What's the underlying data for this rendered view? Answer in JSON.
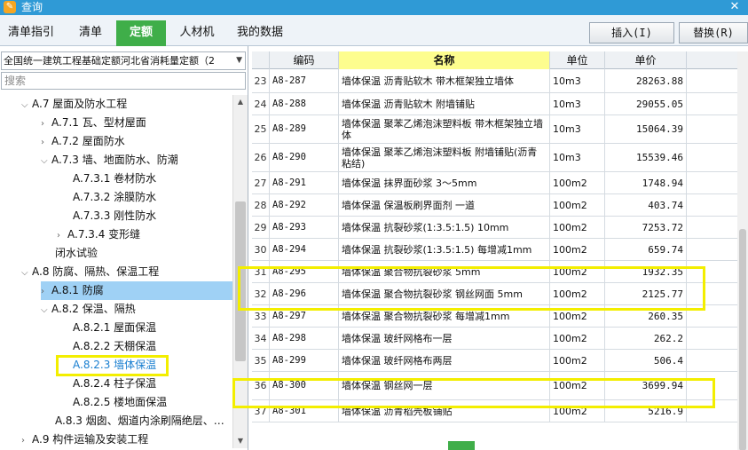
{
  "window": {
    "title": "查询",
    "close_label": "✕"
  },
  "tabs": [
    {
      "label": "清单指引",
      "active": false
    },
    {
      "label": "清单",
      "active": false
    },
    {
      "label": "定额",
      "active": true
    },
    {
      "label": "人材机",
      "active": false
    },
    {
      "label": "我的数据",
      "active": false
    }
  ],
  "buttons": {
    "insert": "插入(I)",
    "replace": "替换(R)"
  },
  "left": {
    "quota_selector": "全国统一建筑工程基础定额河北省消耗量定额（2",
    "search_placeholder": "搜索",
    "tree": [
      {
        "label": "A.7 屋面及防水工程",
        "caret": "⌵"
      },
      {
        "label": "A.7.1 瓦、型材屋面",
        "caret": "›"
      },
      {
        "label": "A.7.2 屋面防水",
        "caret": "›"
      },
      {
        "label": "A.7.3 墙、地面防水、防潮",
        "caret": "⌵"
      },
      {
        "label": "A.7.3.1 卷材防水",
        "caret": ""
      },
      {
        "label": "A.7.3.2 涂膜防水",
        "caret": ""
      },
      {
        "label": "A.7.3.3 刚性防水",
        "caret": ""
      },
      {
        "label": "A.7.3.4 变形缝",
        "caret": "›"
      },
      {
        "label": "闭水试验",
        "caret": ""
      },
      {
        "label": "A.8 防腐、隔热、保温工程",
        "caret": "⌵"
      },
      {
        "label": "A.8.1 防腐",
        "caret": "›"
      },
      {
        "label": "A.8.2 保温、隔热",
        "caret": "⌵"
      },
      {
        "label": "A.8.2.1 屋面保温",
        "caret": ""
      },
      {
        "label": "A.8.2.2 天棚保温",
        "caret": ""
      },
      {
        "label": "A.8.2.3 墙体保温",
        "caret": ""
      },
      {
        "label": "A.8.2.4 柱子保温",
        "caret": ""
      },
      {
        "label": "A.8.2.5 楼地面保温",
        "caret": ""
      },
      {
        "label": "A.8.3 烟囱、烟道内涂刷隔绝层、…",
        "caret": ""
      },
      {
        "label": "A.9 构件运输及安装工程",
        "caret": "›"
      }
    ]
  },
  "grid": {
    "columns": [
      "",
      "编码",
      "名称",
      "单位",
      "单价"
    ],
    "rows": [
      {
        "no": "23",
        "code": "A8-287",
        "name": "墙体保温 沥青贴软木 带木框架独立墙体",
        "unit": "10m3",
        "price": "28263.88"
      },
      {
        "no": "24",
        "code": "A8-288",
        "name": "墙体保温 沥青贴软木 附墙铺贴",
        "unit": "10m3",
        "price": "29055.05"
      },
      {
        "no": "25",
        "code": "A8-289",
        "name": "墙体保温 聚苯乙烯泡沫塑料板 带木框架独立墙体",
        "unit": "10m3",
        "price": "15064.39"
      },
      {
        "no": "26",
        "code": "A8-290",
        "name": "墙体保温 聚苯乙烯泡沫塑料板 附墙铺贴(沥青粘结)",
        "unit": "10m3",
        "price": "15539.46"
      },
      {
        "no": "27",
        "code": "A8-291",
        "name": "墙体保温 抹界面砂浆 3～5mm",
        "unit": "100m2",
        "price": "1748.94"
      },
      {
        "no": "28",
        "code": "A8-292",
        "name": "墙体保温 保温板刷界面剂 一道",
        "unit": "100m2",
        "price": "403.74"
      },
      {
        "no": "29",
        "code": "A8-293",
        "name": "墙体保温 抗裂砂浆(1:3.5:1.5) 10mm",
        "unit": "100m2",
        "price": "7253.72"
      },
      {
        "no": "30",
        "code": "A8-294",
        "name": "墙体保温 抗裂砂浆(1:3.5:1.5) 每增减1mm",
        "unit": "100m2",
        "price": "659.74"
      },
      {
        "no": "31",
        "code": "A8-295",
        "name": "墙体保温 聚合物抗裂砂浆 5mm",
        "unit": "100m2",
        "price": "1932.35"
      },
      {
        "no": "32",
        "code": "A8-296",
        "name": "墙体保温 聚合物抗裂砂浆 钢丝网面 5mm",
        "unit": "100m2",
        "price": "2125.77"
      },
      {
        "no": "33",
        "code": "A8-297",
        "name": "墙体保温 聚合物抗裂砂浆 每增减1mm",
        "unit": "100m2",
        "price": "260.35"
      },
      {
        "no": "34",
        "code": "A8-298",
        "name": "墙体保温 玻纤网格布一层",
        "unit": "100m2",
        "price": "262.2"
      },
      {
        "no": "35",
        "code": "A8-299",
        "name": "墙体保温 玻纤网格布两层",
        "unit": "100m2",
        "price": "506.4"
      },
      {
        "no": "36",
        "code": "A8-300",
        "name": "墙体保温 钢丝网一层",
        "unit": "100m2",
        "price": "3699.94"
      },
      {
        "no": "37",
        "code": "A8-301",
        "name": "墙体保温 沥青稻壳板铺贴",
        "unit": "100m2",
        "price": "5216.9"
      }
    ]
  },
  "colors": {
    "titlebar": "#2f9ad6",
    "active_tab": "#3fae49",
    "highlight_box": "#f3ee00",
    "selected_node": "#9fd1f5"
  }
}
